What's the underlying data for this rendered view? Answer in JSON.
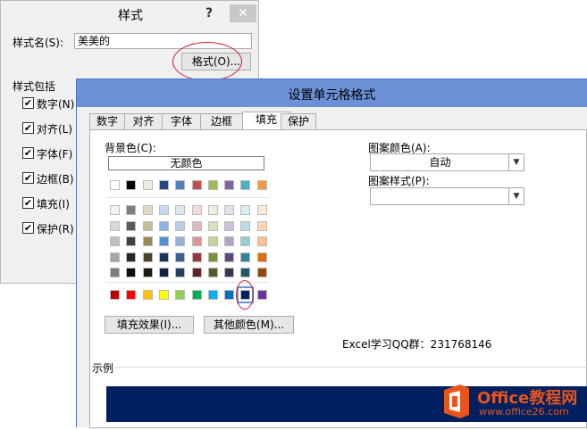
{
  "style_dialog": {
    "title": "样式",
    "help": "?",
    "close": "✕",
    "style_name_label": "样式名(S):",
    "style_name_value": "美美的",
    "format_button": "格式(O)...",
    "includes_label": "样式包括",
    "checks": [
      {
        "label": "数字(N)",
        "checked": true
      },
      {
        "label": "对齐(L)",
        "checked": true
      },
      {
        "label": "字体(F)",
        "checked": true
      },
      {
        "label": "边框(B)",
        "checked": true
      },
      {
        "label": "填充(I)",
        "checked": true
      },
      {
        "label": "保护(R)",
        "checked": true
      }
    ]
  },
  "format_dialog": {
    "title": "设置单元格格式",
    "tabs": [
      "数字",
      "对齐",
      "字体",
      "边框",
      "填充",
      "保护"
    ],
    "active_tab": "填充",
    "bg_color_label": "背景色(C):",
    "no_color": "无颜色",
    "palette_top": [
      "#ffffff",
      "#000000",
      "#eeece1",
      "#1f497d",
      "#4f81bd",
      "#c0504d",
      "#9bbb59",
      "#8064a2",
      "#4bacc6",
      "#f79646"
    ],
    "palette_tints": [
      [
        "#f2f2f2",
        "#7f7f7f",
        "#ddd9c3",
        "#c6d9f0",
        "#dbe5f1",
        "#f2dcdb",
        "#ebf1dd",
        "#e5e0ec",
        "#dbeef3",
        "#fdeada"
      ],
      [
        "#d8d8d8",
        "#595959",
        "#c4bd97",
        "#8db3e2",
        "#b8cce4",
        "#e5b9b7",
        "#d7e3bc",
        "#ccc1d9",
        "#b7dde8",
        "#fbd5b5"
      ],
      [
        "#bfbfbf",
        "#3f3f3f",
        "#938953",
        "#548dd4",
        "#95b3d7",
        "#d99694",
        "#c3d69b",
        "#b2a2c7",
        "#92cddc",
        "#fac08f"
      ],
      [
        "#a5a5a5",
        "#262626",
        "#494429",
        "#17365d",
        "#366092",
        "#953734",
        "#76923c",
        "#5f497a",
        "#31859b",
        "#e36c09"
      ],
      [
        "#7f7f7f",
        "#0c0c0c",
        "#1d1b10",
        "#0f243e",
        "#244061",
        "#632423",
        "#4f6128",
        "#3f3151",
        "#205867",
        "#974806"
      ]
    ],
    "palette_standard": [
      "#c00000",
      "#ff0000",
      "#ffc000",
      "#ffff00",
      "#92d050",
      "#00b050",
      "#00b0f0",
      "#0070c0",
      "#002060",
      "#7030a0"
    ],
    "selected_standard_index": 8,
    "fill_effects_button": "填充效果(I)...",
    "more_colors_button": "其他颜色(M)...",
    "pattern_color_label": "图案颜色(A):",
    "pattern_color_value": "自动",
    "pattern_style_label": "图案样式(P):",
    "pattern_style_value": "",
    "sample_label": "示例",
    "sample_color": "#002060"
  },
  "watermark": {
    "qq_text": "Excel学习QQ群：231768146",
    "brand_name": "Office教程网",
    "brand_url": "www.office26.com",
    "brand_color": "#e8541c"
  }
}
